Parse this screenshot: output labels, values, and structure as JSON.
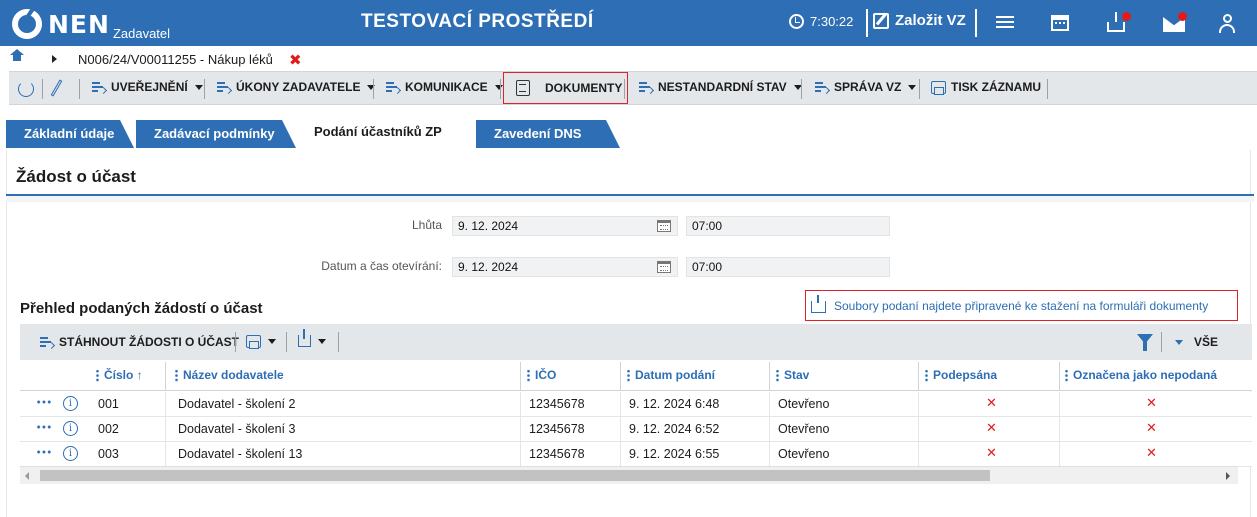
{
  "header": {
    "brand": "NEN",
    "brand_sub": "Zadavatel",
    "environment": "TESTOVACÍ PROSTŘEDÍ",
    "time": "7:30:22",
    "create_vz": "Založit VZ",
    "icons": [
      "clock-icon",
      "edit-icon",
      "menu-icon",
      "calendar-icon",
      "inbox-icon",
      "mail-icon",
      "user-icon"
    ],
    "notification_color": "#e21a1a"
  },
  "breadcrumb": {
    "text": "N006/24/V00011255 - Nákup léků",
    "close": "✖"
  },
  "toolbar": {
    "uverejneni": "UVEŘEJNĚNÍ",
    "ukony": "ÚKONY ZADAVATELE",
    "komunikace": "KOMUNIKACE",
    "dokumenty": "DOKUMENTY",
    "nestandardni": "NESTANDARDNÍ STAV",
    "sprava": "SPRÁVA VZ",
    "tisk": "TISK ZÁZNAMU"
  },
  "tabs": [
    {
      "label": "Základní údaje"
    },
    {
      "label": "Zadávací podmínky"
    },
    {
      "label": "Podání účastníků ZP"
    },
    {
      "label": "Zavedení DNS"
    }
  ],
  "section": {
    "title": "Žádost o účast"
  },
  "form": {
    "lhuta_label": "Lhůta",
    "lhuta_date": "9. 12. 2024",
    "lhuta_time": "07:00",
    "otevreni_label": "Datum a čas otevírání:",
    "otevreni_date": "9. 12. 2024",
    "otevreni_time": "07:00"
  },
  "overview": {
    "title": "Přehled podaných žádostí o účast",
    "files_link": "Soubory podaní najdete připravené ke stažení na formuláři dokumenty"
  },
  "grid": {
    "download_label": "STÁHNOUT ŽÁDOSTI O ÚČAST",
    "all_label": "VŠE",
    "columns": {
      "cislo": "Číslo ↑",
      "nazev": "Název dodavatele",
      "ico": "IČO",
      "datum": "Datum podání",
      "stav": "Stav",
      "podepsana": "Podepsána",
      "nepodana": "Označena jako nepodaná"
    },
    "rows": [
      {
        "info": "i",
        "cislo": "001",
        "nazev": "Dodavatel - školení 2",
        "ico": "12345678",
        "datum": "9. 12. 2024 6:48",
        "stav": "Otevřeno",
        "podepsana": "✕",
        "nepodana": "✕"
      },
      {
        "info": "i",
        "cislo": "002",
        "nazev": "Dodavatel - školení 3",
        "ico": "12345678",
        "datum": "9. 12. 2024 6:52",
        "stav": "Otevřeno",
        "podepsana": "✕",
        "nepodana": "✕"
      },
      {
        "info": "i",
        "cislo": "003",
        "nazev": "Dodavatel - školení 13",
        "ico": "12345678",
        "datum": "9. 12. 2024 6:55",
        "stav": "Otevřeno",
        "podepsana": "✕",
        "nepodana": "✕"
      }
    ]
  }
}
